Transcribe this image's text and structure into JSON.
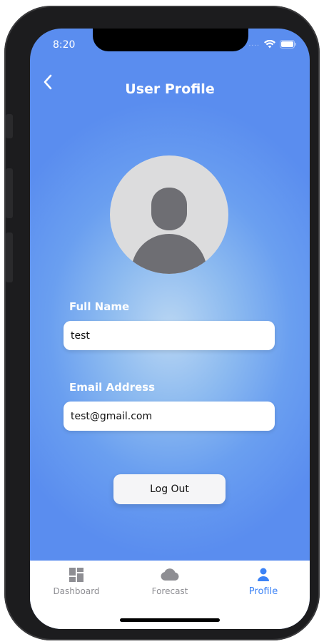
{
  "status_bar": {
    "time": "8:20",
    "signal_dots": "....",
    "icons": [
      "wifi-icon",
      "battery-icon"
    ]
  },
  "header": {
    "title": "User Profile",
    "back_icon": "chevron-left-icon"
  },
  "avatar": {
    "icon": "user-placeholder-icon"
  },
  "form": {
    "full_name_label": "Full Name",
    "full_name_value": "test",
    "email_label": "Email Address",
    "email_value": "test@gmail.com"
  },
  "actions": {
    "logout_label": "Log Out"
  },
  "tabbar": {
    "tabs": [
      {
        "label": "Dashboard",
        "icon": "dashboard-icon",
        "active": false
      },
      {
        "label": "Forecast",
        "icon": "cloud-icon",
        "active": false
      },
      {
        "label": "Profile",
        "icon": "person-icon",
        "active": true
      }
    ]
  },
  "colors": {
    "accent": "#3b82f6",
    "background_top": "#5a8def",
    "background_center": "#b9d6f3",
    "inactive_tab": "#8e8e93",
    "avatar_bg": "#dcdcdd",
    "avatar_fg": "#6e6e73"
  }
}
